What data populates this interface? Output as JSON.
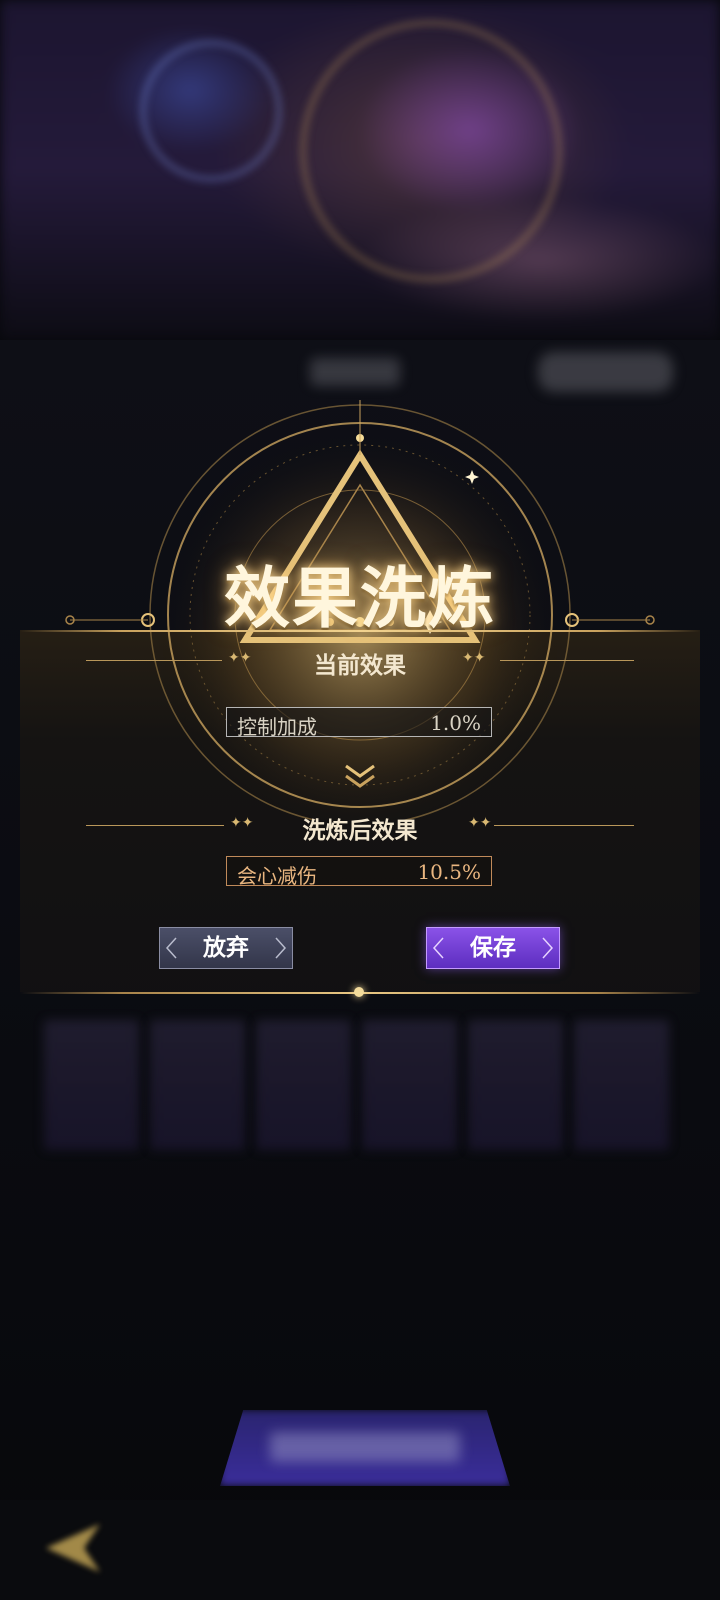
{
  "dialog": {
    "title": "效果洗炼",
    "current_section_label": "当前效果",
    "current_stat": {
      "name": "控制加成",
      "value": "1.0%"
    },
    "after_section_label": "洗炼后效果",
    "after_stat": {
      "name": "会心减伤",
      "value": "10.5%"
    },
    "abandon_label": "放弃",
    "save_label": "保存"
  },
  "colors": {
    "gold": "#e9c884",
    "current_stat_text": "#d9d3c4",
    "after_stat_text": "#e9b680",
    "save_button": "#7040d8",
    "abandon_button": "#40435a"
  },
  "icons": [
    "triangle-emblem-icon",
    "double-chevron-down-icon",
    "back-arrow-icon"
  ]
}
